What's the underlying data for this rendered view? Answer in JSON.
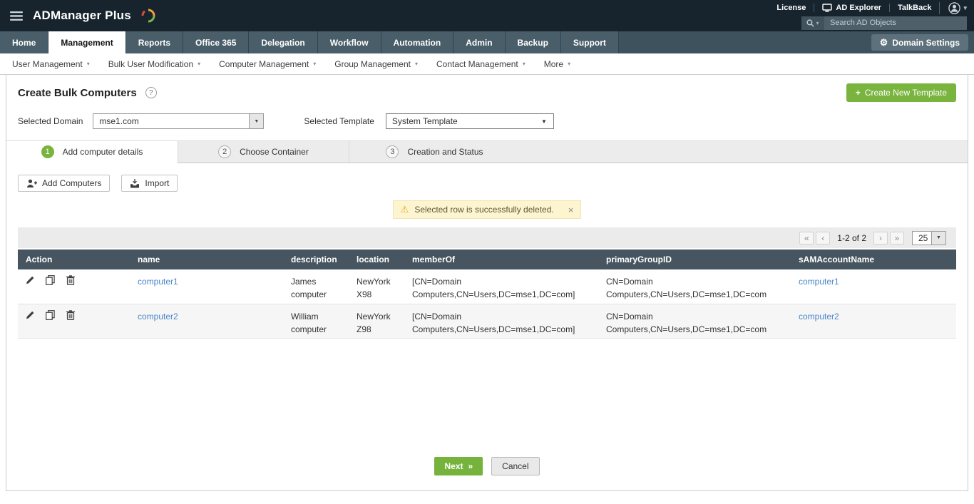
{
  "icons": {
    "caret_down": "▾",
    "select_caret": "▼",
    "gear": "⚙",
    "plus": "+",
    "help": "?",
    "warning": "⚠",
    "close": "×",
    "pager_first": "«",
    "pager_prev": "‹",
    "pager_next": "›",
    "pager_last": "»",
    "next_chevrons": "»"
  },
  "topbar": {
    "brand": "ADManager Plus",
    "links": [
      "License",
      "AD Explorer",
      "TalkBack"
    ],
    "search_placeholder": "Search AD Objects"
  },
  "nav": {
    "tabs": [
      "Home",
      "Management",
      "Reports",
      "Office 365",
      "Delegation",
      "Workflow",
      "Automation",
      "Admin",
      "Backup",
      "Support"
    ],
    "active_tab": "Management",
    "domain_settings_label": "Domain Settings"
  },
  "subnav": {
    "items": [
      "User Management",
      "Bulk User Modification",
      "Computer Management",
      "Group Management",
      "Contact Management",
      "More"
    ]
  },
  "page": {
    "title": "Create Bulk Computers",
    "create_template_label": "Create New Template",
    "selected_domain_label": "Selected Domain",
    "selected_domain_value": "mse1.com",
    "selected_template_label": "Selected Template",
    "selected_template_value": "System Template"
  },
  "wizard": {
    "steps": [
      {
        "num": "1",
        "label": "Add computer details"
      },
      {
        "num": "2",
        "label": "Choose Container"
      },
      {
        "num": "3",
        "label": "Creation and Status"
      }
    ]
  },
  "toolbar": {
    "add_computers_label": "Add Computers",
    "import_label": "Import"
  },
  "notification": {
    "message": "Selected row is successfully deleted."
  },
  "pagination": {
    "range": "1-2 of 2",
    "page_size": "25"
  },
  "table": {
    "headers": [
      "Action",
      "name",
      "description",
      "location",
      "memberOf",
      "primaryGroupID",
      "sAMAccountName"
    ],
    "rows": [
      {
        "name": "computer1",
        "description": "James computer",
        "location": "NewYork X98",
        "memberOf": "[CN=Domain Computers,CN=Users,DC=mse1,DC=com]",
        "primaryGroupID": "CN=Domain Computers,CN=Users,DC=mse1,DC=com",
        "sAMAccountName": "computer1"
      },
      {
        "name": "computer2",
        "description": "William computer",
        "location": "NewYork Z98",
        "memberOf": "[CN=Domain Computers,CN=Users,DC=mse1,DC=com]",
        "primaryGroupID": "CN=Domain Computers,CN=Users,DC=mse1,DC=com",
        "sAMAccountName": "computer2"
      }
    ]
  },
  "footer": {
    "next_label": "Next",
    "cancel_label": "Cancel"
  },
  "colors": {
    "accent_green": "#78b43e",
    "header_dark": "#17242e",
    "nav_slate": "#3e525d",
    "table_header": "#46555f",
    "link_blue": "#4a86c8",
    "notice_bg": "#fdf5d0"
  }
}
